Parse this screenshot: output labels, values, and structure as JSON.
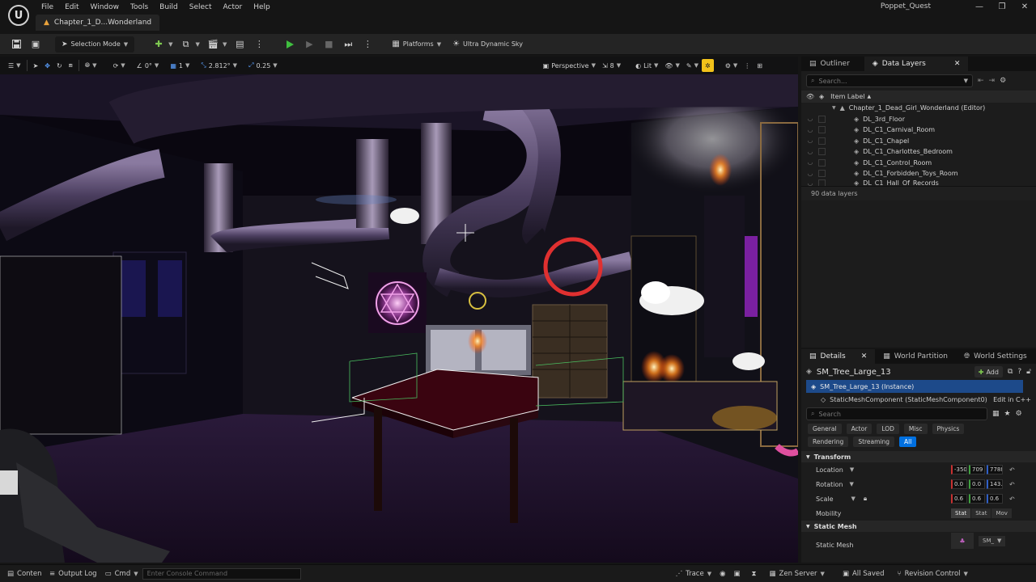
{
  "app": {
    "logo_glyph": "U",
    "menu": [
      "File",
      "Edit",
      "Window",
      "Tools",
      "Build",
      "Select",
      "Actor",
      "Help"
    ],
    "document_tab": "Chapter_1_D...Wonderland",
    "project_name": "Poppet_Quest",
    "window_controls": [
      "—",
      "❐",
      "✕"
    ]
  },
  "toolbar": {
    "selection_mode": "Selection Mode",
    "platforms": "Platforms",
    "sky": "Ultra Dynamic Sky"
  },
  "viewport_toolbar": {
    "rotation_snap": "0°",
    "scale_step": "1",
    "camera_speed": "2.812°",
    "grid_value": "0.25",
    "perspective": "Perspective",
    "fov_value": "8",
    "lit": "Lit"
  },
  "outliner": {
    "tabs": [
      "Outliner",
      "Data Layers"
    ],
    "search_placeholder": "Search...",
    "column_header": "Item Label",
    "root_item": "Chapter_1_Dead_Girl_Wonderland (Editor)",
    "items": [
      "DL_3rd_Floor",
      "DL_C1_Carnival_Room",
      "DL_C1_Chapel",
      "DL_C1_Charlottes_Bedroom",
      "DL_C1_Control_Room",
      "DL_C1_Forbidden_Toys_Room",
      "DL_C1_Hall_Of_Records"
    ],
    "count_label": "90 data layers"
  },
  "details": {
    "tabs": [
      "Details",
      "World Partition",
      "World Settings"
    ],
    "actor_name": "SM_Tree_Large_13",
    "add_label": "Add",
    "instance_label": "SM_Tree_Large_13 (Instance)",
    "component_label": "StaticMeshComponent (StaticMeshComponent0)",
    "edit_cpp": "Edit in C++",
    "search_placeholder": "Search",
    "categories_row1": [
      "General",
      "Actor",
      "LOD",
      "Misc",
      "Physics"
    ],
    "categories_row2": [
      "Rendering",
      "Streaming",
      "All"
    ],
    "active_category": "All",
    "transform_header": "Transform",
    "location_label": "Location",
    "location_values": [
      "-350",
      "709",
      "7788"
    ],
    "rotation_label": "Rotation",
    "rotation_values": [
      "0.0",
      "0.0",
      "143."
    ],
    "scale_label": "Scale",
    "scale_values": [
      "0.6",
      "0.6",
      "0.6"
    ],
    "mobility_label": "Mobility",
    "mobility_options": [
      "Stat",
      "Stat",
      "Mov"
    ],
    "mobility_selected": "Stat",
    "static_mesh_header": "Static Mesh",
    "static_mesh_label": "Static Mesh",
    "static_mesh_value": "SM_"
  },
  "statusbar": {
    "content_drawer": "Content Drawer",
    "output_log": "Output Log",
    "cmd": "Cmd",
    "console_placeholder": "Enter Console Command",
    "trace": "Trace",
    "zen_server": "Zen Server",
    "all_saved": "All Saved",
    "revision_control": "Revision Control"
  },
  "colors": {
    "accent_blue": "#0070e0",
    "play_green": "#3fbf3f",
    "tab_orange": "#e9a23b",
    "highlight_yellow": "#f2c21a"
  }
}
